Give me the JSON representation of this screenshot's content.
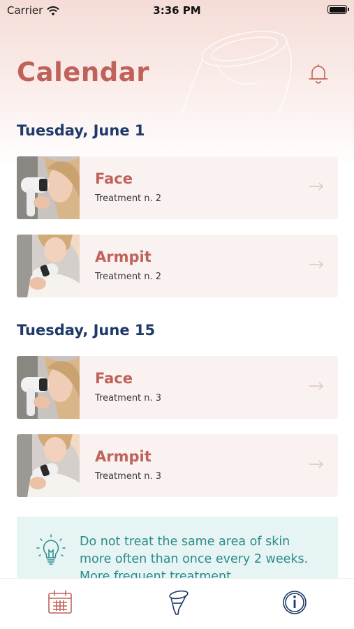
{
  "status_bar": {
    "carrier": "Carrier",
    "time": "3:36 PM"
  },
  "header": {
    "title": "Calendar"
  },
  "sections": [
    {
      "date": "Tuesday, June 1",
      "items": [
        {
          "area": "Face",
          "treatment": "Treatment n. 2"
        },
        {
          "area": "Armpit",
          "treatment": "Treatment n. 2"
        }
      ]
    },
    {
      "date": "Tuesday, June 15",
      "items": [
        {
          "area": "Face",
          "treatment": "Treatment n. 3"
        },
        {
          "area": "Armpit",
          "treatment": "Treatment n. 3"
        }
      ]
    }
  ],
  "tip": {
    "text": "Do not treat the same area of skin more often than once every 2 weeks. More frequent treatment"
  },
  "tabbar": {
    "items": [
      {
        "icon": "calendar-icon"
      },
      {
        "icon": "device-icon"
      },
      {
        "icon": "info-icon"
      }
    ]
  },
  "colors": {
    "accent": "#c0625a",
    "heading": "#1f3a68",
    "tip_bg": "#e6f4f3",
    "tip_text": "#2a8b8a"
  }
}
